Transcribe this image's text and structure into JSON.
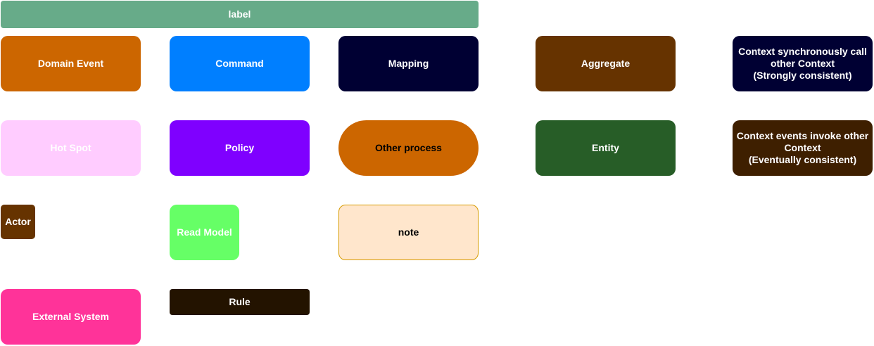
{
  "shapes": {
    "label": {
      "text": "label",
      "fill": "#67AB89",
      "text_color": "#FFFFFF"
    },
    "domain_event": {
      "text": "Domain Event",
      "fill": "#CC6600",
      "text_color": "#FFFFFF"
    },
    "command": {
      "text": "Command",
      "fill": "#007FFF",
      "text_color": "#FFFFFF"
    },
    "mapping": {
      "text": "Mapping",
      "fill": "#000033",
      "text_color": "#FFFFFF"
    },
    "aggregate": {
      "text": "Aggregate",
      "fill": "#663300",
      "text_color": "#FFFFFF"
    },
    "context_sync": {
      "text": "Context synchronously  call other Context\n(Strongly  consistent)",
      "fill": "#000033",
      "text_color": "#FFFFFF"
    },
    "hot_spot": {
      "text": "Hot Spot",
      "fill": "#FFCCFF",
      "text_color": "#FFFFFF"
    },
    "policy": {
      "text": "Policy",
      "fill": "#7F00FF",
      "text_color": "#FFFFFF"
    },
    "other_process": {
      "text": "Other process",
      "fill": "#CC6600",
      "text_color": "#000000"
    },
    "entity": {
      "text": "Entity",
      "fill": "#275D27",
      "text_color": "#FFFFFF"
    },
    "context_events": {
      "text": "Context events invoke other Context\n(Eventually  consistent)",
      "fill": "#3E1F00",
      "text_color": "#FFFFFF"
    },
    "actor": {
      "text": "Actor",
      "fill": "#663300",
      "text_color": "#FFFFFF"
    },
    "read_model": {
      "text": "Read Model",
      "fill": "#66FF66",
      "text_color": "#FFFFFF"
    },
    "note": {
      "text": "note",
      "fill": "#FFE6CC",
      "text_color": "#000000",
      "stroke": "#D79B00"
    },
    "external_system": {
      "text": "External System",
      "fill": "#FF3399",
      "text_color": "#FFFFFF"
    },
    "rule": {
      "text": "Rule",
      "fill": "#231300",
      "text_color": "#FFFFFF"
    }
  }
}
